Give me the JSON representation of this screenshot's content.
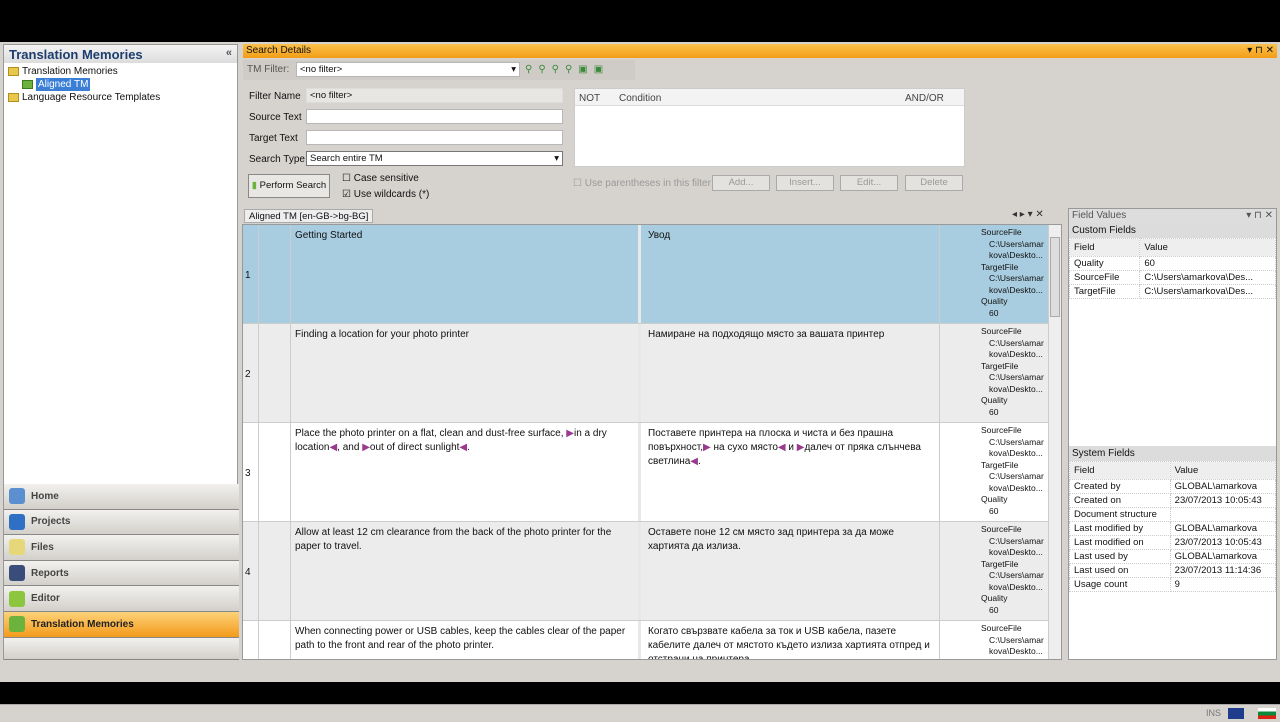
{
  "left_panel": {
    "title": "Translation Memories",
    "collapse": "«",
    "tree": [
      {
        "label": "Translation Memories"
      },
      {
        "label": "Aligned TM",
        "selected": true
      },
      {
        "label": "Language Resource Templates"
      }
    ]
  },
  "nav": [
    {
      "label": "Home",
      "icon": "home-icon"
    },
    {
      "label": "Projects",
      "icon": "projects-icon"
    },
    {
      "label": "Files",
      "icon": "files-icon"
    },
    {
      "label": "Reports",
      "icon": "reports-icon"
    },
    {
      "label": "Editor",
      "icon": "editor-icon"
    },
    {
      "label": "Translation Memories",
      "icon": "translation-memories-icon",
      "active": true
    }
  ],
  "search": {
    "title": "Search Details",
    "tm_filter_label": "TM Filter:",
    "tm_filter_value": "<no filter>",
    "filter_name_label": "Filter Name",
    "filter_name_value": "<no filter>",
    "source_label": "Source Text",
    "target_label": "Target Text",
    "search_type_label": "Search Type",
    "search_type_value": "Search entire TM",
    "perform_search": "Perform Search",
    "case_sensitive": "Case sensitive",
    "case_sensitive_checked": false,
    "use_wildcards": "Use wildcards (*)",
    "use_wildcards_checked": true,
    "cond_cols": [
      "NOT",
      "Condition",
      "AND/OR"
    ],
    "use_parentheses": "Use parentheses in this filter",
    "buttons": [
      "Add...",
      "Insert...",
      "Edit...",
      "Delete"
    ]
  },
  "grid": {
    "tab": "Aligned TM [en-GB->bg-BG]",
    "field_labels": [
      "SourceFile",
      "TargetFile",
      "Quality"
    ],
    "path_line1": "C:\\Users\\amar",
    "path_line2": "kova\\Deskto...",
    "rows": [
      {
        "num": "1",
        "source": "Getting Started",
        "target": "Увод",
        "quality": "60",
        "selected": true
      },
      {
        "num": "2",
        "source": "Finding a location for your photo printer",
        "target": "Намиране на подходящо място за вашата принтер",
        "quality": "60"
      },
      {
        "num": "3",
        "source": "Place the photo printer on a flat, clean and dust-free surface, ▶in a dry location◀, and ▶out of direct sunlight◀.",
        "target": "Поставете принтера на плоска и чиста и без прашна повърхност,▶ на сухо място◀ и ▶далеч от пряка слънчева светлина◀.",
        "quality": "60"
      },
      {
        "num": "4",
        "source": "Allow at least 12 cm clearance from the back of the photo printer for the paper to travel.",
        "target": "Оставете поне 12 см място зад принтера за да може хартията да излиза.",
        "quality": "60"
      },
      {
        "num": "5",
        "source": "When connecting power or USB cables, keep the cables clear of the paper path to the front and rear of the photo printer.",
        "target": "Когато свързвате кабела за ток и USB кабела, пазете кабелите далеч от мястото където излиза хартията отпред и отстрани на принтера.",
        "quality": ""
      }
    ]
  },
  "field_values": {
    "title": "Field Values",
    "custom_title": "Custom Fields",
    "col_field": "Field",
    "col_value": "Value",
    "custom": [
      [
        "Quality",
        "60"
      ],
      [
        "SourceFile",
        "C:\\Users\\amarkova\\Des..."
      ],
      [
        "TargetFile",
        "C:\\Users\\amarkova\\Des..."
      ]
    ],
    "system_title": "System Fields",
    "system": [
      [
        "Created by",
        "GLOBAL\\amarkova"
      ],
      [
        "Created on",
        "23/07/2013 10:05:43"
      ],
      [
        "Document structure",
        ""
      ],
      [
        "Last modified by",
        "GLOBAL\\amarkova"
      ],
      [
        "Last modified on",
        "23/07/2013 10:05:43"
      ],
      [
        "Last used by",
        "GLOBAL\\amarkova"
      ],
      [
        "Last used on",
        "23/07/2013 11:14:36"
      ],
      [
        "Usage count",
        "9"
      ]
    ]
  },
  "status": {
    "ins": "INS"
  },
  "colors": {
    "accent": "#f29d16",
    "selection": "#a9cde0"
  }
}
